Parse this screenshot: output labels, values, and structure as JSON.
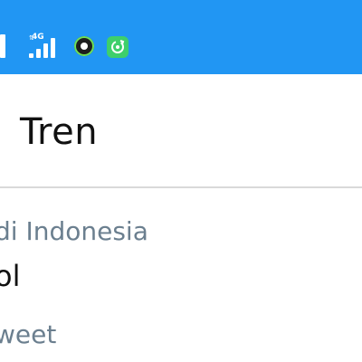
{
  "status_bar": {
    "network_type": "4G",
    "network_arrows": "⇅",
    "color": "#2196f3",
    "icons": [
      "signal-icon",
      "network-4g-icon",
      "notification-app-icon",
      "sync-app-icon"
    ]
  },
  "header": {
    "title": "Tren"
  },
  "trend_item": {
    "location": "di Indonesia",
    "name": "ol",
    "count": "weet"
  }
}
